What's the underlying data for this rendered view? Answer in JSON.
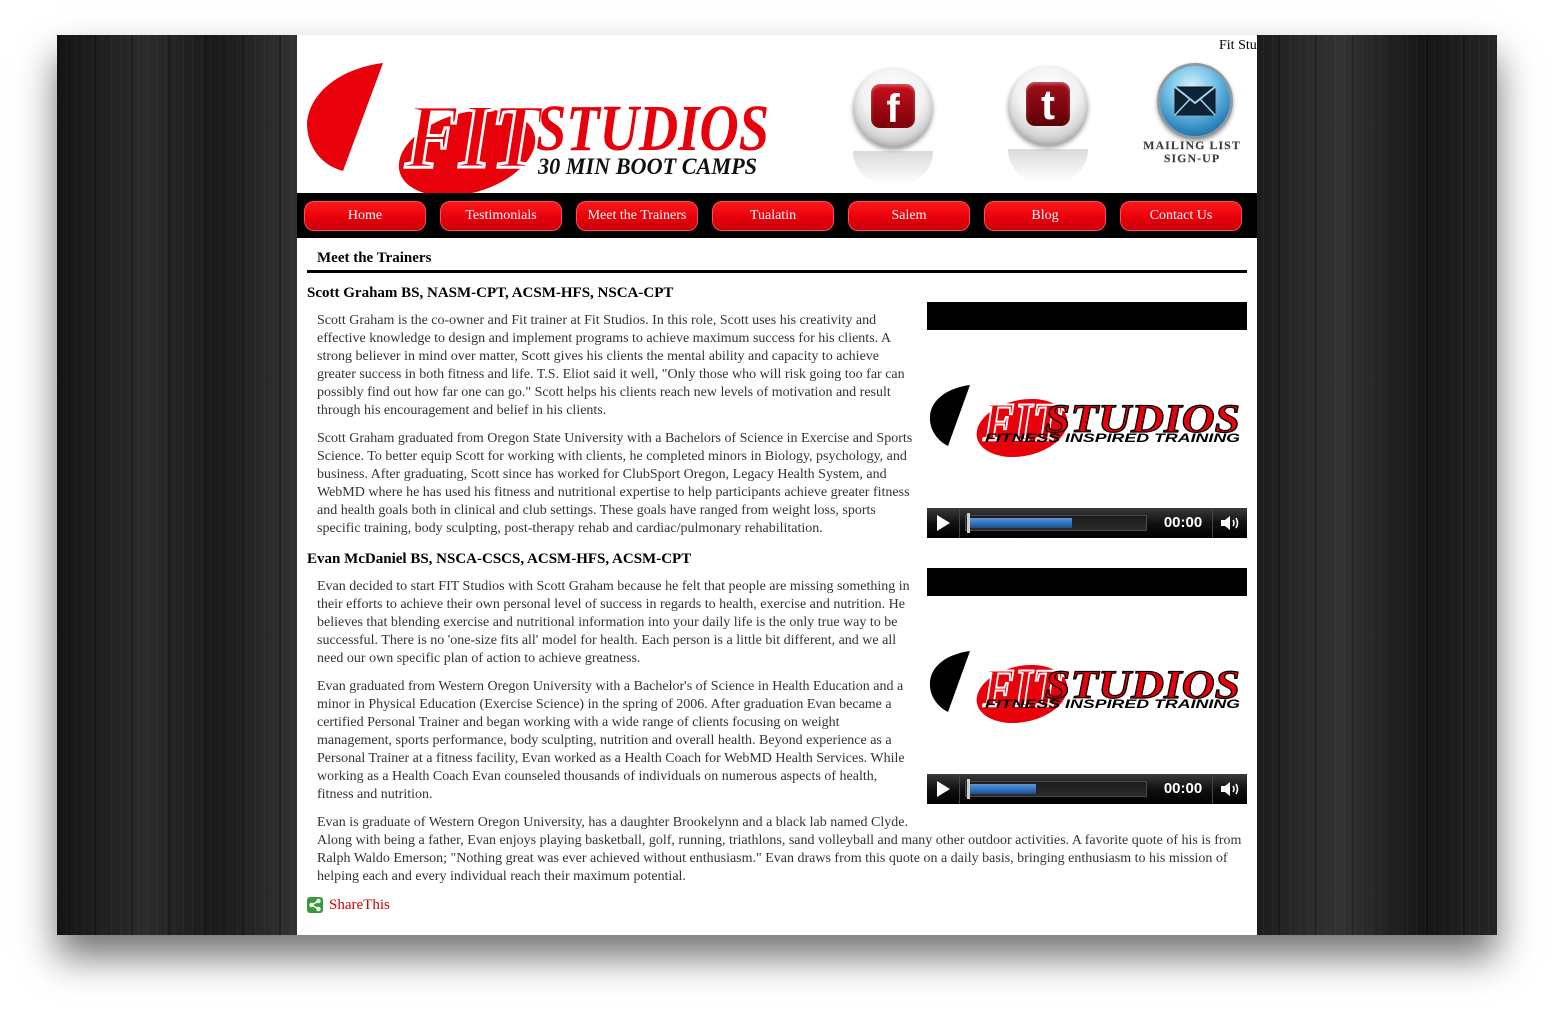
{
  "header": {
    "ticker": "Fit Stu",
    "logo": {
      "fit": "FIT",
      "studios": "STUDIOS",
      "tagline": "30 MIN BOOT CAMPS"
    },
    "social": {
      "facebook": {
        "icon": "facebook-icon",
        "glyph": "f"
      },
      "twitter": {
        "icon": "twitter-icon",
        "glyph": "t"
      },
      "mailing_list": {
        "icon": "envelope-icon",
        "line1": "MAILING LIST",
        "line2": "SIGN-UP"
      }
    }
  },
  "nav": {
    "items": [
      {
        "label": "Home"
      },
      {
        "label": "Testimonials"
      },
      {
        "label": "Meet the Trainers"
      },
      {
        "label": "Tualatin"
      },
      {
        "label": "Salem"
      },
      {
        "label": "Blog"
      },
      {
        "label": "Contact Us"
      }
    ]
  },
  "main": {
    "title": "Meet the Trainers"
  },
  "trainers": [
    {
      "name": "Scott Graham BS, NASM-CPT, ACSM-HFS, NSCA-CPT",
      "paragraphs": [
        "Scott Graham is the co-owner and Fit trainer at Fit Studios. In this role, Scott uses his creativity and effective knowledge to design and implement programs to achieve maximum success for his clients. A strong believer in mind over matter, Scott gives his clients the mental ability and capacity to achieve greater success in both fitness and life. T.S. Eliot said it well, \"Only those who will risk going too far can possibly find out how far one can go.\" Scott helps his clients reach new levels of motivation and result through his encouragement and belief in his clients.",
        "Scott Graham graduated from Oregon State University with a Bachelors of Science in Exercise and Sports Science. To better equip Scott for working with clients, he completed minors in Biology, psychology, and business. After graduating, Scott since has worked for ClubSport Oregon, Legacy Health System, and WebMD where he has used his fitness and nutritional expertise to help participants achieve greater fitness and health goals both in clinical and club settings. These goals have ranged from weight loss, sports specific training, body sculpting, post-therapy rehab and cardiac/pulmonary rehabilitation."
      ],
      "video": {
        "time": "00:00",
        "buffered": 0.6,
        "logo": {
          "fit": "FIT",
          "studios": "STUDIOS",
          "tagline": "FITNESS INSPIRED TRAINING"
        },
        "icons": {
          "play": "play-icon",
          "volume": "speaker-icon"
        }
      }
    },
    {
      "name": "Evan McDaniel BS, NSCA-CSCS, ACSM-HFS, ACSM-CPT",
      "paragraphs": [
        "Evan decided to start FIT Studios with Scott Graham because he felt that people are missing something in their efforts to achieve their own personal level of success in regards to health, exercise and nutrition. He believes that blending exercise and nutritional information into your daily life is the only true way to be successful. There is no 'one-size fits all' model for health. Each person is a little bit different, and we all need our own specific plan of action to achieve greatness.",
        "Evan graduated from Western Oregon University with a Bachelor's of Science in Health Education and a minor in Physical Education (Exercise Science) in the spring of 2006. After graduation Evan became a certified Personal Trainer and began working with a wide range of clients focusing on weight management, sports performance, body sculpting, nutrition and overall health. Beyond experience as a Personal Trainer at a fitness facility, Evan worked as a Health Coach for WebMD Health Services. While working as a Health Coach Evan counseled thousands of individuals on numerous aspects of health, fitness and nutrition.",
        "Evan is graduate of Western Oregon University, has a daughter Brookelynn and a black lab named Clyde. Along with being a father, Evan enjoys playing basketball, golf, running, triathlons, sand volleyball and many other outdoor activities. A favorite quote of his is from Ralph Waldo Emerson; \"Nothing great was ever achieved without enthusiasm.\" Evan draws from this quote on a daily basis, bringing enthusiasm to his mission of helping each and every individual reach their maximum potential."
      ],
      "video": {
        "time": "00:00",
        "buffered": 0.4,
        "logo": {
          "fit": "FIT",
          "studios": "STUDIOS",
          "tagline": "FITNESS INSPIRED TRAINING"
        },
        "icons": {
          "play": "play-icon",
          "volume": "speaker-icon"
        }
      }
    }
  ],
  "share": {
    "label": "ShareThis",
    "icon": "share-icon"
  },
  "colors": {
    "brand_red": "#e8000b",
    "nav_background": "#000000",
    "body_text": "#333333",
    "progress_blue": "#2e6db4",
    "share_green": "#3a9a3a",
    "share_text": "#d40000"
  }
}
